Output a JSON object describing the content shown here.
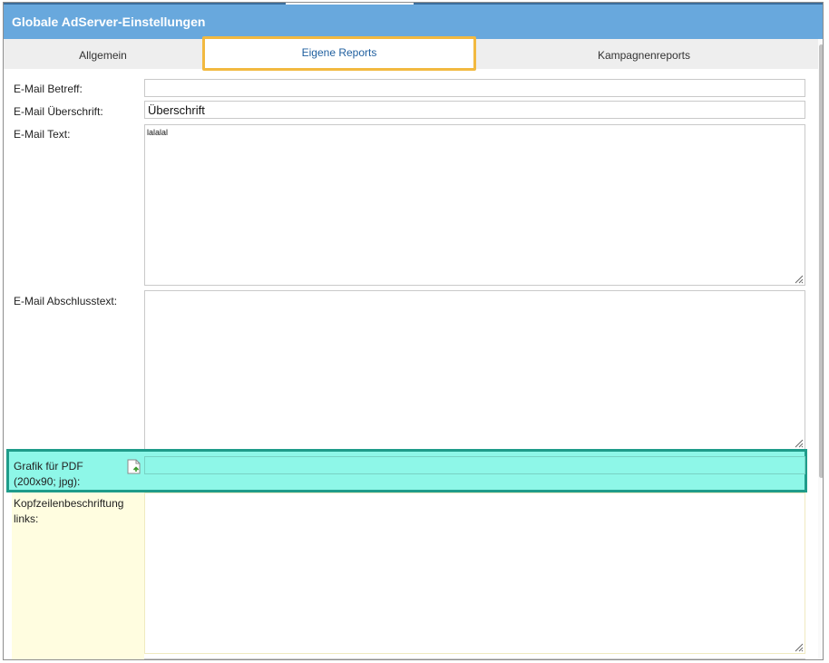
{
  "window": {
    "title": "Globale AdServer-Einstellungen"
  },
  "tabs": [
    {
      "label": "Allgemein",
      "active": false
    },
    {
      "label": "Eigene Reports",
      "active": true
    },
    {
      "label": "Kampagnenreports",
      "active": false
    }
  ],
  "form": {
    "email_subject": {
      "label": "E-Mail Betreff:",
      "value": ""
    },
    "email_heading": {
      "label": "E-Mail Überschrift:",
      "value": "Überschrift"
    },
    "email_text": {
      "label": "E-Mail Text:",
      "value": "lalalal"
    },
    "email_closing": {
      "label": "E-Mail Abschlusstext:",
      "value": ""
    },
    "pdf_graphic": {
      "label_line1": "Grafik für PDF",
      "label_line2": "(200x90; jpg):",
      "value": ""
    },
    "header_left": {
      "label_line1": "Kopfzeilenbeschriftung",
      "label_line2": "links:",
      "value": ""
    }
  },
  "colors": {
    "titlebar": "#68a8dd",
    "active_tab_border": "#f2b940",
    "highlight_fill": "#8ef7e8",
    "highlight_border": "#1f9c8a",
    "label_highlight": "#fffde0"
  },
  "icons": {
    "upload": "file-upload-icon",
    "resize": "resize-grip-icon"
  }
}
